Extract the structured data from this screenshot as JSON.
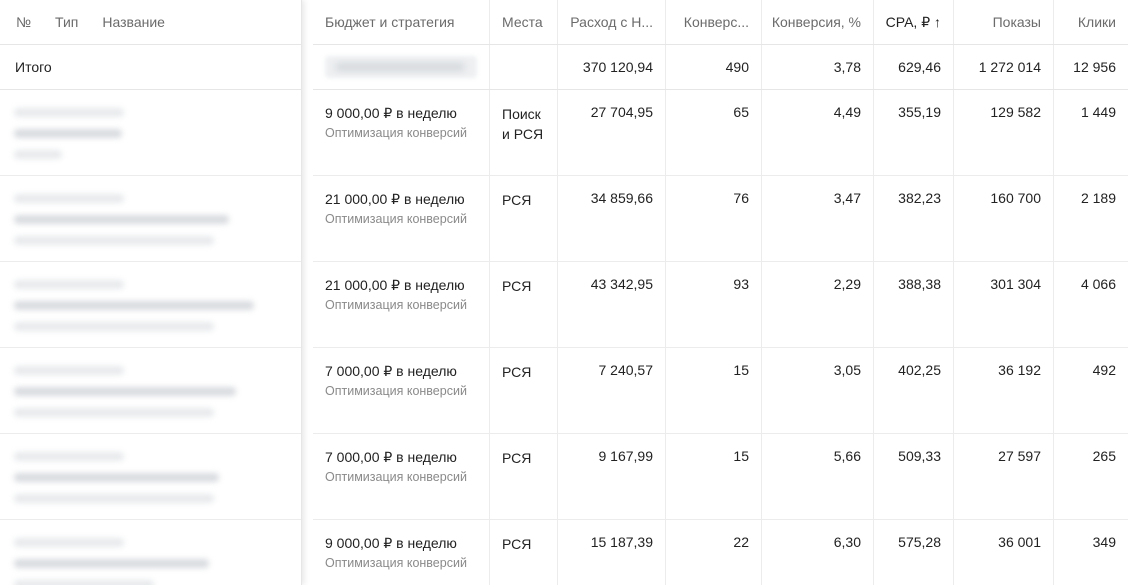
{
  "header": {
    "num": "№",
    "type": "Тип",
    "name": "Название",
    "budget": "Бюджет и стратегия",
    "places": "Места",
    "spend": "Расход с Н...",
    "conversions": "Конверс...",
    "conversion_rate": "Конверсия, %",
    "cpa": "CPA, ₽ ↑",
    "shows": "Показы",
    "clicks": "Клики"
  },
  "total": {
    "label": "Итого",
    "spend": "370 120,94",
    "conversions": "490",
    "conversion_rate": "3,78",
    "cpa": "629,46",
    "shows": "1 272 014",
    "clicks": "12 956"
  },
  "rows": [
    {
      "budget": "9 000,00 ₽ в неделю",
      "strategy": "Оптимизация конверсий",
      "places": "Поиск и РСЯ",
      "spend": "27 704,95",
      "conversions": "65",
      "conversion_rate": "4,49",
      "cpa": "355,19",
      "shows": "129 582",
      "clicks": "1 449"
    },
    {
      "budget": "21 000,00 ₽ в неделю",
      "strategy": "Оптимизация конверсий",
      "places": "РСЯ",
      "spend": "34 859,66",
      "conversions": "76",
      "conversion_rate": "3,47",
      "cpa": "382,23",
      "shows": "160 700",
      "clicks": "2 189"
    },
    {
      "budget": "21 000,00 ₽ в неделю",
      "strategy": "Оптимизация конверсий",
      "places": "РСЯ",
      "spend": "43 342,95",
      "conversions": "93",
      "conversion_rate": "2,29",
      "cpa": "388,38",
      "shows": "301 304",
      "clicks": "4 066"
    },
    {
      "budget": "7 000,00 ₽ в неделю",
      "strategy": "Оптимизация конверсий",
      "places": "РСЯ",
      "spend": "7 240,57",
      "conversions": "15",
      "conversion_rate": "3,05",
      "cpa": "402,25",
      "shows": "36 192",
      "clicks": "492"
    },
    {
      "budget": "7 000,00 ₽ в неделю",
      "strategy": "Оптимизация конверсий",
      "places": "РСЯ",
      "spend": "9 167,99",
      "conversions": "15",
      "conversion_rate": "5,66",
      "cpa": "509,33",
      "shows": "27 597",
      "clicks": "265"
    },
    {
      "budget": "9 000,00 ₽ в неделю",
      "strategy": "Оптимизация конверсий",
      "places": "РСЯ",
      "spend": "15 187,39",
      "conversions": "22",
      "conversion_rate": "6,30",
      "cpa": "575,28",
      "shows": "36 001",
      "clicks": "349"
    }
  ]
}
